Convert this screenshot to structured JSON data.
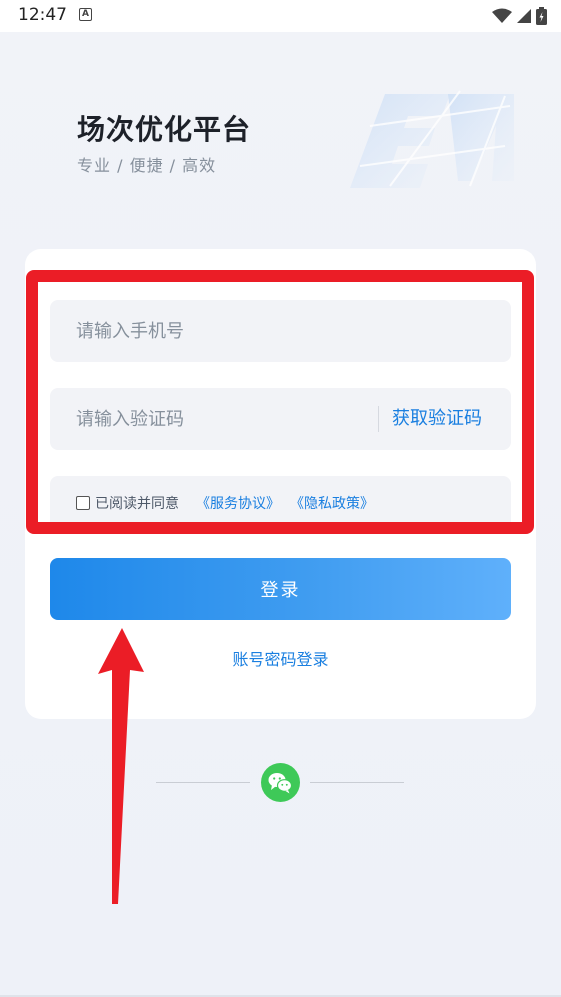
{
  "status_bar": {
    "time": "12:47",
    "indicator": "A",
    "icons": [
      "wifi-icon",
      "signal-icon",
      "battery-icon"
    ]
  },
  "header": {
    "title": "场次优化平台",
    "slogan": "专业 / 便捷 / 高效"
  },
  "form": {
    "phone_placeholder": "请输入手机号",
    "code_placeholder": "请输入验证码",
    "get_code_label": "获取验证码",
    "agree_text": "已阅读并同意",
    "service_link": "《服务协议》",
    "privacy_link": "《隐私政策》",
    "login_label": "登录",
    "password_login_label": "账号密码登录"
  },
  "social": {
    "wechat_icon": "wechat-icon"
  },
  "colors": {
    "accent": "#1a7fe0",
    "button_start": "#1e88ea",
    "button_end": "#5fb0fb",
    "wechat": "#3ec958",
    "annotation": "#eb1d26"
  }
}
